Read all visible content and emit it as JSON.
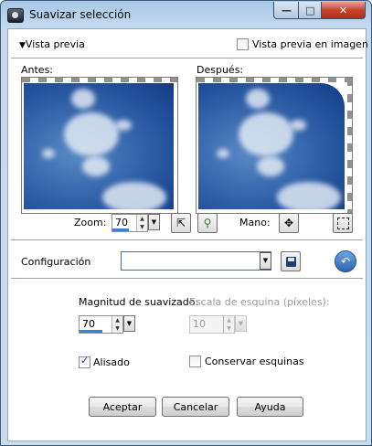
{
  "window": {
    "title": "Suavizar selección"
  },
  "preview": {
    "toggle_label": "Vista previa",
    "in_image_label": "Vista previa en imagen",
    "in_image_checked": false,
    "before_label": "Antes:",
    "after_label": "Después:",
    "zoom_label": "Zoom:",
    "zoom_value": "70",
    "zoom_level": 0.7,
    "pan_label": "Mano:"
  },
  "config": {
    "label": "Configuración",
    "value": ""
  },
  "settings": {
    "magnitude_label": "Magnitud de suavizado:",
    "magnitude_value": "70",
    "magnitude_level": 0.7,
    "corner_label": "Escala de esquina (píxeles):",
    "corner_value": "10",
    "antialias_label": "Alisado",
    "antialias_checked": true,
    "preserve_label": "Conservar esquinas",
    "preserve_checked": false
  },
  "buttons": {
    "ok": "Aceptar",
    "cancel": "Cancelar",
    "help": "Ayuda"
  },
  "colors": {
    "close_button": "#c7452c",
    "sky": "#23519c",
    "value_bar": "#3c7fd6"
  }
}
